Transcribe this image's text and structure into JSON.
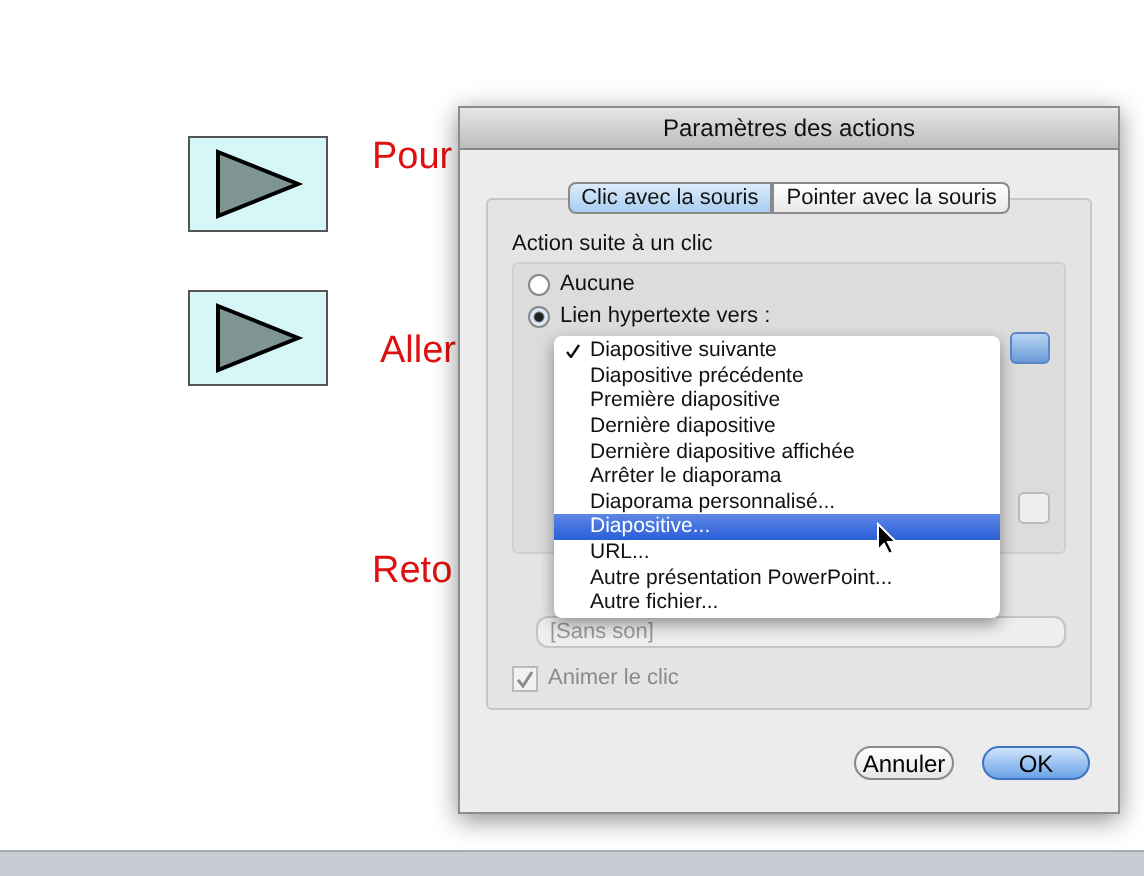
{
  "slide": {
    "items": [
      {
        "label": "Pour",
        "kind": "button_text"
      },
      {
        "label": "Aller",
        "kind": "button_text"
      },
      {
        "label": "Reto",
        "kind": "text"
      }
    ]
  },
  "dialog": {
    "title": "Paramètres des actions",
    "tabs": [
      {
        "label": "Clic avec la souris",
        "selected": true
      },
      {
        "label": "Pointer avec la souris",
        "selected": false
      }
    ],
    "group_title": "Action suite à un clic",
    "options": [
      {
        "label": "Aucune",
        "selected": false
      },
      {
        "label": "Lien hypertexte vers :",
        "selected": true
      }
    ],
    "sound": {
      "value": "[Sans son]"
    },
    "animate": {
      "label": "Animer le clic",
      "checked": true,
      "disabled": true
    },
    "buttons": [
      {
        "label": "Annuler",
        "default": false
      },
      {
        "label": "OK",
        "default": true
      }
    ]
  },
  "menu": {
    "items": [
      {
        "label": "Diapositive suivante",
        "checked": true,
        "selected": false
      },
      {
        "label": "Diapositive précédente",
        "checked": false,
        "selected": false
      },
      {
        "label": "Première diapositive",
        "checked": false,
        "selected": false
      },
      {
        "label": "Dernière diapositive",
        "checked": false,
        "selected": false
      },
      {
        "label": "Dernière diapositive affichée",
        "checked": false,
        "selected": false
      },
      {
        "label": "Arrêter le diaporama",
        "checked": false,
        "selected": false
      },
      {
        "label": "Diaporama personnalisé...",
        "checked": false,
        "selected": false
      },
      {
        "label": "Diapositive...",
        "checked": false,
        "selected": true
      },
      {
        "label": "URL...",
        "checked": false,
        "selected": false
      },
      {
        "label": "Autre présentation PowerPoint...",
        "checked": false,
        "selected": false
      },
      {
        "label": "Autre fichier...",
        "checked": false,
        "selected": false
      }
    ]
  }
}
